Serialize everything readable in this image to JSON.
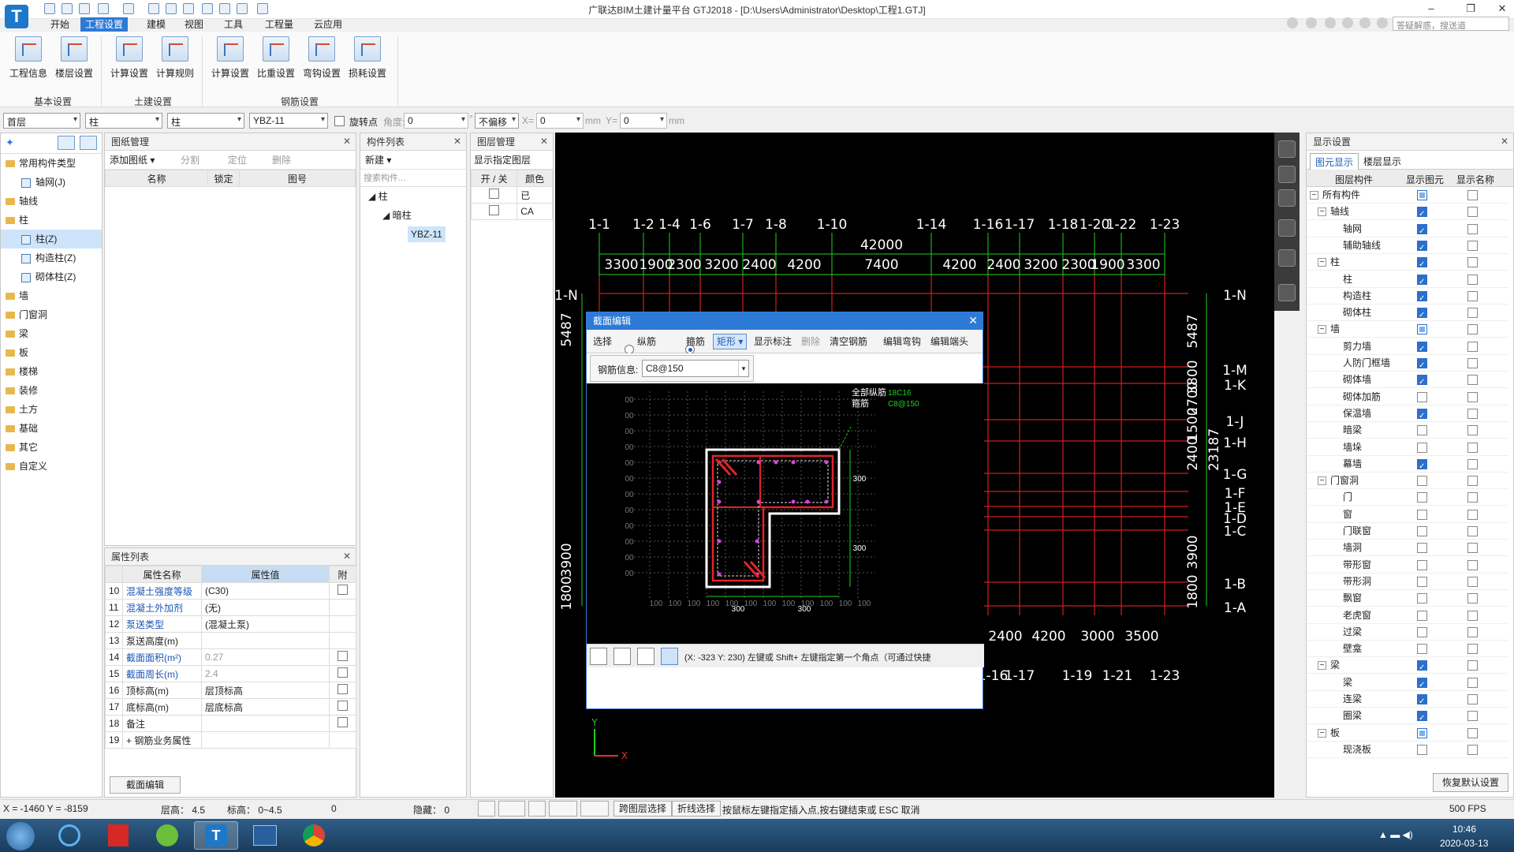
{
  "title": "广联达BIM土建计量平台 GTJ2018 - [D:\\Users\\Administrator\\Desktop\\工程1.GTJ]",
  "app_logo": "T",
  "menu": [
    "开始",
    "工程设置",
    "建模",
    "视图",
    "工具",
    "工程量",
    "云应用"
  ],
  "menu_active_index": 1,
  "help_search_placeholder": "答疑解惑，搜送道",
  "window_controls": [
    "–",
    "❐",
    "✕"
  ],
  "ribbon": {
    "buttons": [
      "工程信息",
      "楼层设置",
      "计算设置",
      "计算规则",
      "计算设置",
      "比重设置",
      "弯钩设置",
      "损耗设置"
    ],
    "groups": [
      "基本设置",
      "土建设置",
      "钢筋设置"
    ]
  },
  "toolbar": {
    "floor": "首层",
    "type1": "柱",
    "type2": "柱",
    "component": "YBZ-11",
    "rotate_label": "旋转点",
    "angle_label": "角度:",
    "angle_value": "0",
    "offset": "不偏移",
    "x_label": "X=",
    "x_value": "0",
    "mm1": "mm",
    "y_label": "Y=",
    "y_value": "0",
    "mm2": "mm"
  },
  "nav_tree": {
    "root": "常用构件类型",
    "items": [
      "轴网(J)",
      "轴线",
      "柱",
      "柱(Z)",
      "构造柱(Z)",
      "砌体柱(Z)",
      "墙",
      "门窗洞",
      "梁",
      "板",
      "楼梯",
      "装修",
      "土方",
      "基础",
      "其它",
      "自定义"
    ]
  },
  "drawing_mgmt": {
    "title": "图纸管理",
    "toolbar": [
      "添加图纸",
      "分割",
      "定位",
      "删除"
    ],
    "columns": [
      "名称",
      "锁定",
      "图号"
    ]
  },
  "component_list": {
    "title": "构件列表",
    "new_label": "新建",
    "search_placeholder": "搜索构件...",
    "tree": [
      "柱",
      "暗柱",
      "YBZ-11"
    ]
  },
  "layer_mgmt": {
    "title": "图层管理",
    "toolbar": "显示指定图层",
    "columns": [
      "开 / 关",
      "颜色"
    ],
    "rows": [
      "已",
      "CA"
    ]
  },
  "properties": {
    "title": "属性列表",
    "columns": [
      "属性名称",
      "属性值",
      "附"
    ],
    "rows": [
      {
        "n": "10",
        "name": "混凝土强度等级",
        "value": "(C30)",
        "blue": true,
        "chk": true
      },
      {
        "n": "11",
        "name": "混凝土外加剂",
        "value": "(无)",
        "blue": true,
        "chk": false
      },
      {
        "n": "12",
        "name": "泵送类型",
        "value": "(混凝土泵)",
        "blue": true,
        "chk": false
      },
      {
        "n": "13",
        "name": "泵送高度(m)",
        "value": "",
        "blue": false,
        "chk": false
      },
      {
        "n": "14",
        "name": "截面面积(m²)",
        "value": "0.27",
        "blue": true,
        "chk": true,
        "gray": true
      },
      {
        "n": "15",
        "name": "截面周长(m)",
        "value": "2.4",
        "blue": true,
        "chk": true,
        "gray": true
      },
      {
        "n": "16",
        "name": "顶标高(m)",
        "value": "层顶标高",
        "blue": false,
        "chk": true
      },
      {
        "n": "17",
        "name": "底标高(m)",
        "value": "层底标高",
        "blue": false,
        "chk": true
      },
      {
        "n": "18",
        "name": "备注",
        "value": "",
        "blue": false,
        "chk": true
      },
      {
        "n": "19",
        "name": "钢筋业务属性",
        "value": "",
        "blue": false,
        "chk": false,
        "plus": true
      }
    ],
    "bottom_button": "截面编辑"
  },
  "cad": {
    "axis_top": [
      "1-1",
      "1-2",
      "1-4",
      "1-6",
      "1-7",
      "1-8",
      "1-10",
      "1-14",
      "1-16",
      "1-17",
      "1-18",
      "1-20",
      "1-22",
      "1-23"
    ],
    "total_dim": "42000",
    "dims_top": [
      "3300",
      "1900",
      "2300",
      "3200",
      "2400",
      "4200",
      "7400",
      "4200",
      "2400",
      "3200",
      "2300",
      "1900",
      "3300"
    ],
    "axis_right": [
      "1-N",
      "1-M",
      "1-K",
      "1-J",
      "1-H",
      "1-G",
      "1-F",
      "1-E",
      "1-D",
      "1-C",
      "1-B",
      "1-A"
    ],
    "axis_left": [
      "1-N"
    ],
    "left_dims": [
      "5487",
      "3900",
      "1800"
    ],
    "right_dims": [
      "5487",
      "23187",
      "3800",
      "2700",
      "1500",
      "2400",
      "3900",
      "1800"
    ],
    "bottom_dims": [
      "2400",
      "4200",
      "3000",
      "3500"
    ],
    "axis_bottom": [
      "1-16",
      "1-17",
      "1-19",
      "1-21",
      "1-23"
    ]
  },
  "dialog": {
    "title": "截面编辑",
    "tools": [
      "选择",
      "纵筋",
      "箍筋",
      "矩形",
      "显示标注",
      "删除",
      "清空钢筋",
      "编辑弯钩",
      "编辑端头"
    ],
    "rebar_label": "钢筋信息:",
    "rebar_value": "C8@150",
    "annot_all": "全部纵筋",
    "annot_all_val": "18C16",
    "annot_stirrup": "箍筋",
    "annot_stirrup_val": "C8@150",
    "dim_300": "300",
    "grid_left_labels": [
      "00",
      "00",
      "00",
      "00",
      "00",
      "00",
      "00",
      "00",
      "00",
      "00",
      "00",
      "00"
    ],
    "grid_bottom_labels": [
      "100",
      "100",
      "100",
      "100",
      "100",
      "100",
      "100",
      "100",
      "100",
      "100",
      "100",
      "100"
    ],
    "status": "(X: -323 Y: 230)  左键或 Shift+ 左键指定第一个角点（可通过快捷"
  },
  "display_settings": {
    "title": "显示设置",
    "tabs": [
      "图元显示",
      "楼层显示"
    ],
    "columns": [
      "图层构件",
      "显示图元",
      "显示名称"
    ],
    "rows": [
      {
        "label": "所有构件",
        "level": 0,
        "exp": true,
        "show": "part",
        "name": false
      },
      {
        "label": "轴线",
        "level": 1,
        "exp": true,
        "show": "on",
        "name": false
      },
      {
        "label": "轴网",
        "level": 2,
        "show": "on",
        "name": false
      },
      {
        "label": "辅助轴线",
        "level": 2,
        "show": "on",
        "name": false
      },
      {
        "label": "柱",
        "level": 1,
        "exp": true,
        "show": "on",
        "name": false
      },
      {
        "label": "柱",
        "level": 2,
        "show": "on",
        "name": false
      },
      {
        "label": "构造柱",
        "level": 2,
        "show": "on",
        "name": false
      },
      {
        "label": "砌体柱",
        "level": 2,
        "show": "on",
        "name": false
      },
      {
        "label": "墙",
        "level": 1,
        "exp": true,
        "show": "part",
        "name": false
      },
      {
        "label": "剪力墙",
        "level": 2,
        "show": "on",
        "name": false
      },
      {
        "label": "人防门框墙",
        "level": 2,
        "show": "on",
        "name": false
      },
      {
        "label": "砌体墙",
        "level": 2,
        "show": "on",
        "name": false
      },
      {
        "label": "砌体加筋",
        "level": 2,
        "show": "off",
        "name": false
      },
      {
        "label": "保温墙",
        "level": 2,
        "show": "on",
        "name": false
      },
      {
        "label": "暗梁",
        "level": 2,
        "show": "off",
        "name": false
      },
      {
        "label": "墙垛",
        "level": 2,
        "show": "off",
        "name": false
      },
      {
        "label": "幕墙",
        "level": 2,
        "show": "on",
        "name": false
      },
      {
        "label": "门窗洞",
        "level": 1,
        "exp": true,
        "show": "off",
        "name": false
      },
      {
        "label": "门",
        "level": 2,
        "show": "off",
        "name": false
      },
      {
        "label": "窗",
        "level": 2,
        "show": "off",
        "name": false
      },
      {
        "label": "门联窗",
        "level": 2,
        "show": "off",
        "name": false
      },
      {
        "label": "墙洞",
        "level": 2,
        "show": "off",
        "name": false
      },
      {
        "label": "带形窗",
        "level": 2,
        "show": "off",
        "name": false
      },
      {
        "label": "带形洞",
        "level": 2,
        "show": "off",
        "name": false
      },
      {
        "label": "飘窗",
        "level": 2,
        "show": "off",
        "name": false
      },
      {
        "label": "老虎窗",
        "level": 2,
        "show": "off",
        "name": false
      },
      {
        "label": "过梁",
        "level": 2,
        "show": "off",
        "name": false
      },
      {
        "label": "壁龛",
        "level": 2,
        "show": "off",
        "name": false
      },
      {
        "label": "梁",
        "level": 1,
        "exp": true,
        "show": "on",
        "name": false
      },
      {
        "label": "梁",
        "level": 2,
        "show": "on",
        "name": false
      },
      {
        "label": "连梁",
        "level": 2,
        "show": "on",
        "name": false
      },
      {
        "label": "圈梁",
        "level": 2,
        "show": "on",
        "name": false
      },
      {
        "label": "板",
        "level": 1,
        "exp": true,
        "show": "part",
        "name": false
      },
      {
        "label": "现浇板",
        "level": 2,
        "show": "off",
        "name": false
      }
    ],
    "restore_button": "恢复默认设置"
  },
  "status": {
    "coords": "X = -1460 Y = -8159",
    "floor_height": "层高： 4.5",
    "elevation": "标高： 0~4.5",
    "zero": "0",
    "hidden": "隐藏：  0",
    "cross_layer": "跨图层选择",
    "polyline": "折线选择",
    "hint": "按鼠标左键指定插入点,按右键结束或 ESC 取消",
    "fps": "500 FPS"
  },
  "taskbar": {
    "time": "10:46",
    "date": "2020-03-13"
  }
}
